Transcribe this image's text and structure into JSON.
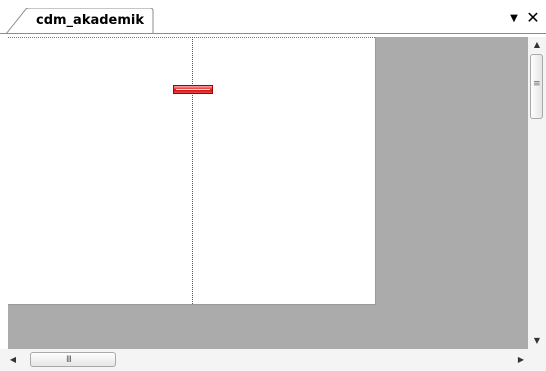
{
  "tab": {
    "title": "cdm_akademik",
    "menu_icon": "▼",
    "close_icon": "✕"
  },
  "scrollbars": {
    "up_icon": "▲",
    "down_icon": "▼",
    "left_icon": "◀",
    "right_icon": "▶",
    "vgrip": "≡",
    "hgrip": "III"
  },
  "colors": {
    "workspace": "#ababab",
    "page": "#ffffff",
    "entity": "#e33333"
  }
}
